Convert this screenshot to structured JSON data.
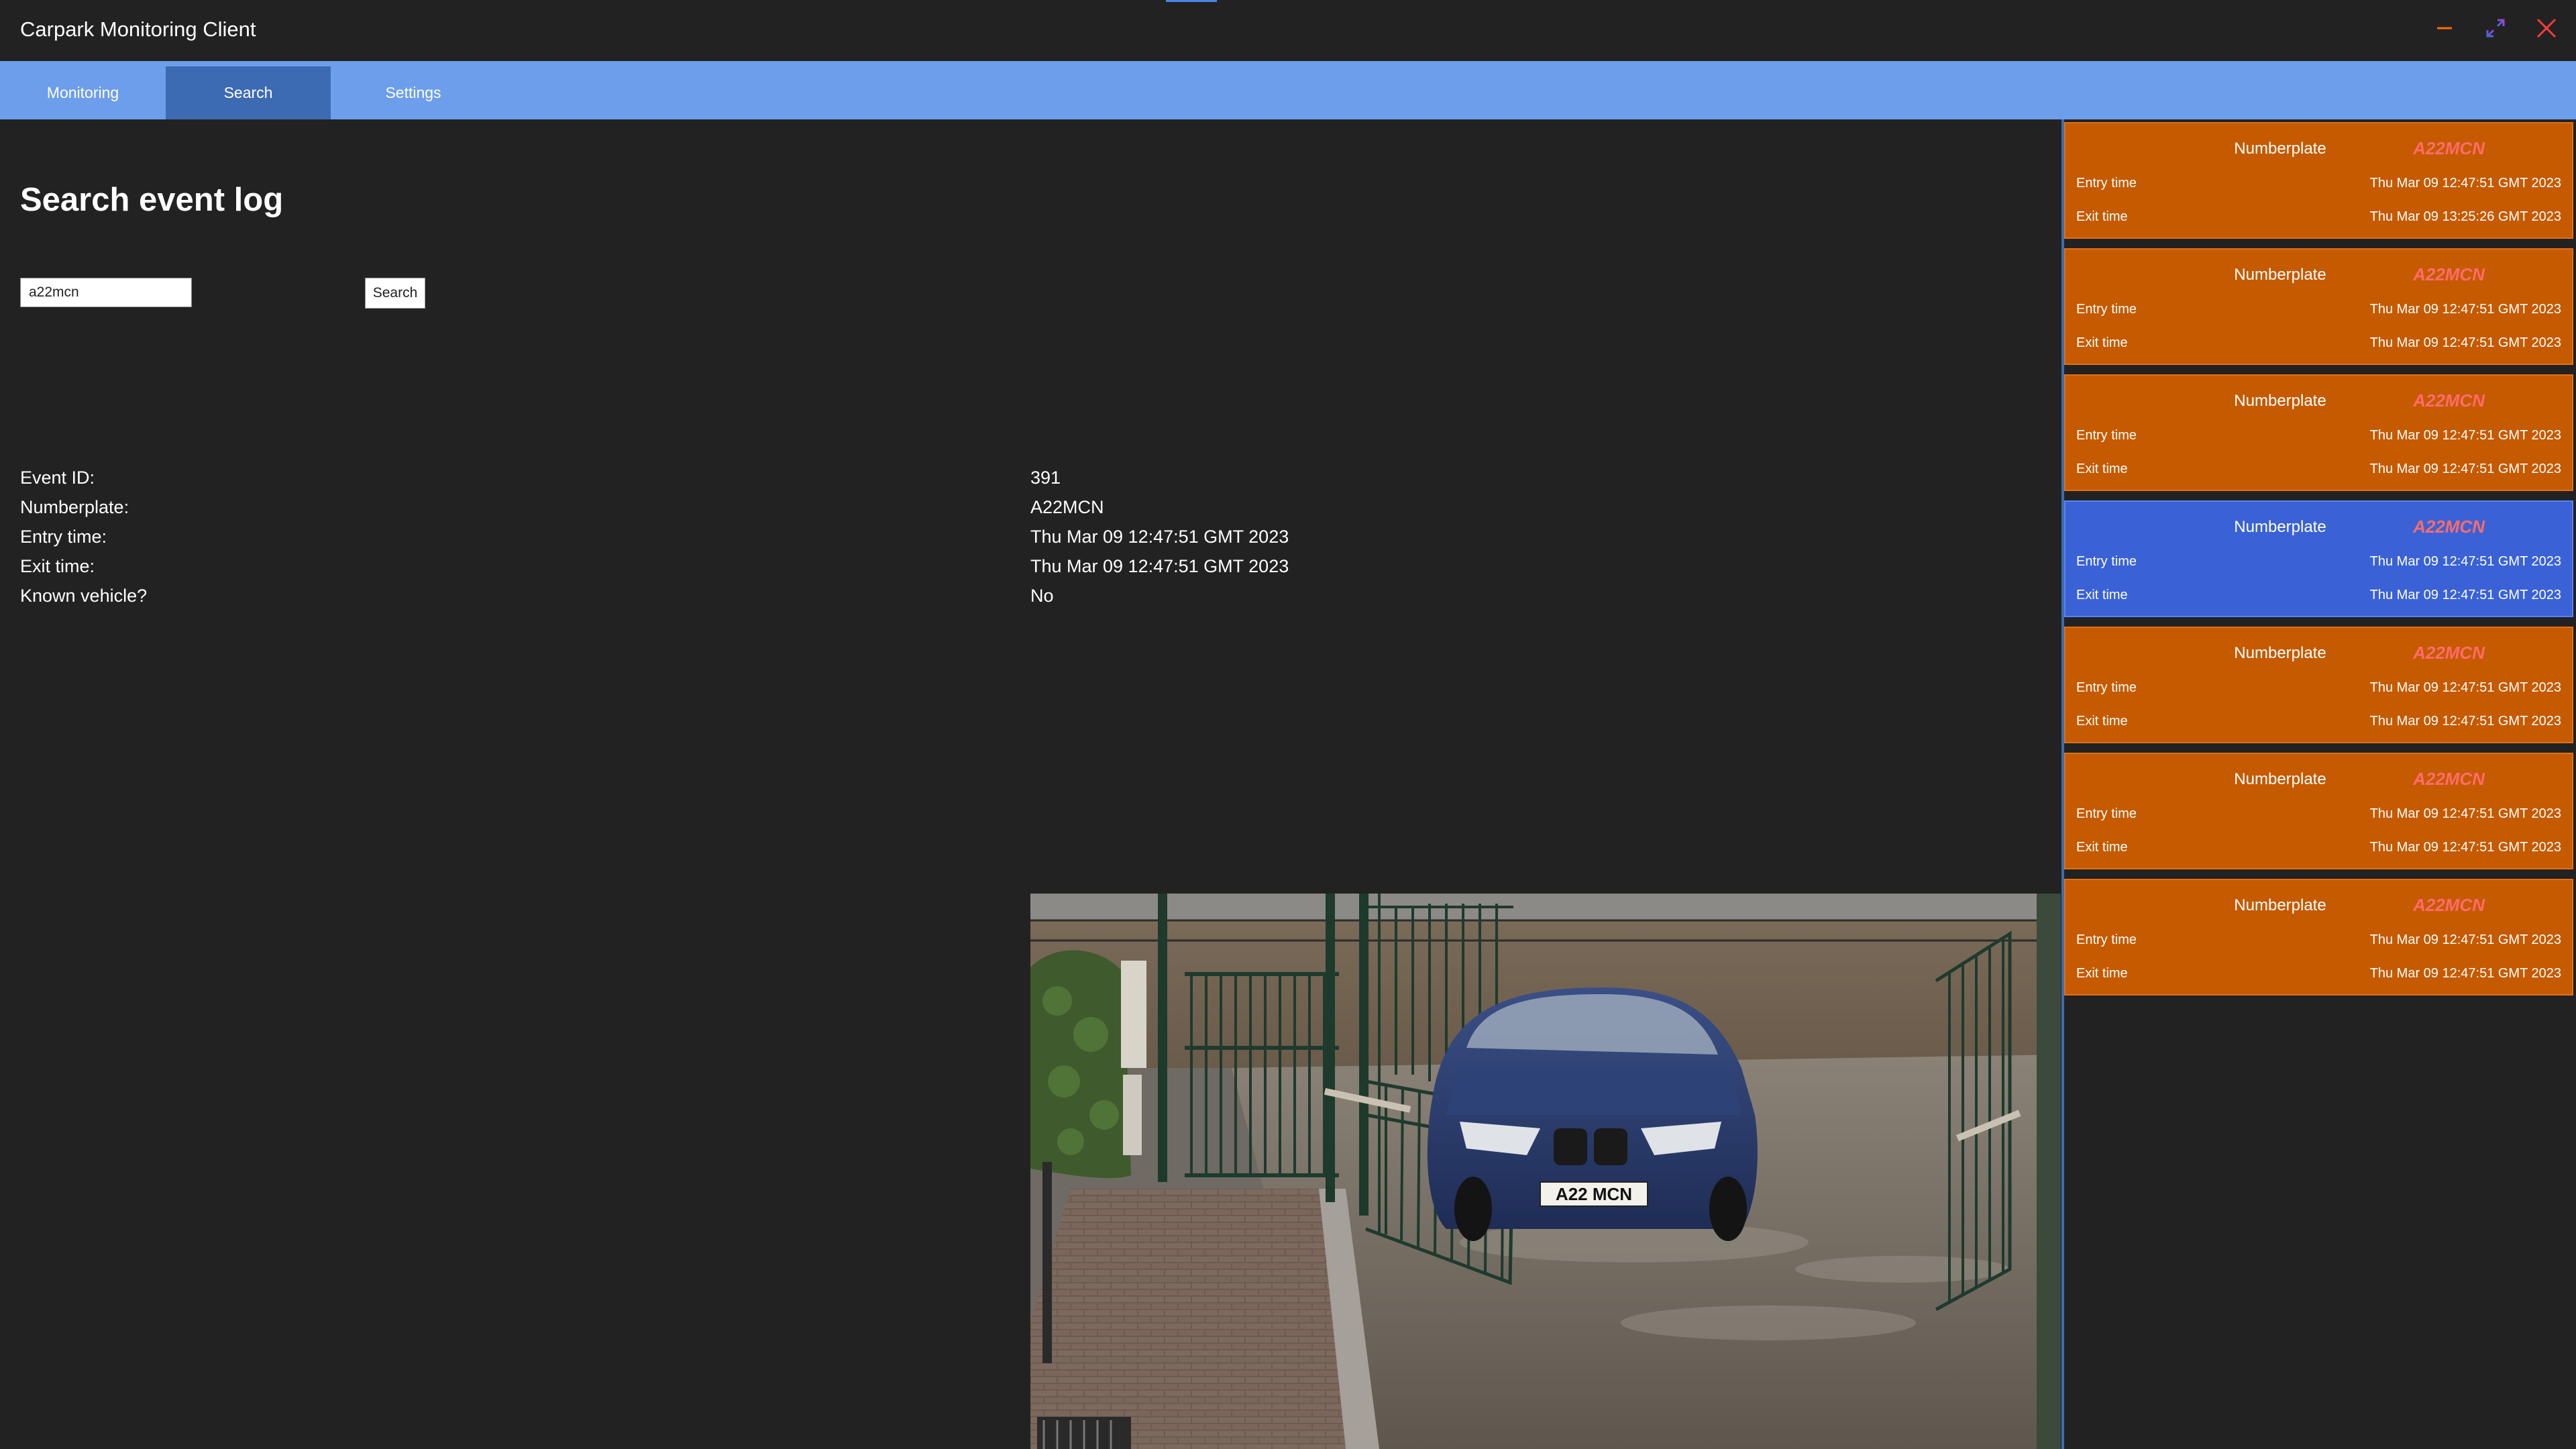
{
  "window": {
    "title": "Carpark Monitoring Client",
    "controls": [
      "minimize-icon",
      "maximize-icon",
      "close-icon"
    ],
    "colors": {
      "minimize": "#ff6d00",
      "maximize": "#7a4fd8",
      "close": "#ff3b3b"
    }
  },
  "tabs": [
    {
      "label": "Monitoring",
      "active": false
    },
    {
      "label": "Search",
      "active": true
    },
    {
      "label": "Settings",
      "active": false
    }
  ],
  "search": {
    "heading": "Search event log",
    "query": "a22mcn",
    "button_label": "Search"
  },
  "details": {
    "labels": [
      "Event ID:",
      "Numberplate:",
      "Entry time:",
      "Exit time:",
      "Known vehicle?"
    ],
    "values": [
      "391",
      "A22MCN",
      "Thu Mar 09 12:47:51 GMT 2023",
      "Thu Mar 09 12:47:51 GMT 2023",
      "No"
    ]
  },
  "camera": {
    "plate_text": "A22 MCN"
  },
  "events": {
    "numberplate_label": "Numberplate",
    "entry_label": "Entry time",
    "exit_label": "Exit time",
    "items": [
      {
        "plate": "A22MCN",
        "entry": "Thu Mar 09 12:47:51 GMT 2023",
        "exit": "Thu Mar 09 13:25:26 GMT 2023",
        "selected": false
      },
      {
        "plate": "A22MCN",
        "entry": "Thu Mar 09 12:47:51 GMT 2023",
        "exit": "Thu Mar 09 12:47:51 GMT 2023",
        "selected": false
      },
      {
        "plate": "A22MCN",
        "entry": "Thu Mar 09 12:47:51 GMT 2023",
        "exit": "Thu Mar 09 12:47:51 GMT 2023",
        "selected": false
      },
      {
        "plate": "A22MCN",
        "entry": "Thu Mar 09 12:47:51 GMT 2023",
        "exit": "Thu Mar 09 12:47:51 GMT 2023",
        "selected": true
      },
      {
        "plate": "A22MCN",
        "entry": "Thu Mar 09 12:47:51 GMT 2023",
        "exit": "Thu Mar 09 12:47:51 GMT 2023",
        "selected": false
      },
      {
        "plate": "A22MCN",
        "entry": "Thu Mar 09 12:47:51 GMT 2023",
        "exit": "Thu Mar 09 12:47:51 GMT 2023",
        "selected": false
      },
      {
        "plate": "A22MCN",
        "entry": "Thu Mar 09 12:47:51 GMT 2023",
        "exit": "Thu Mar 09 12:47:51 GMT 2023",
        "selected": false
      }
    ]
  },
  "colors": {
    "tabbar": "#6d9eeb",
    "active_tab": "#3d6bb3",
    "card": "#c55a00",
    "card_selected": "#3a62d6",
    "plate_text": "#ff6b6b",
    "background": "#222222"
  }
}
